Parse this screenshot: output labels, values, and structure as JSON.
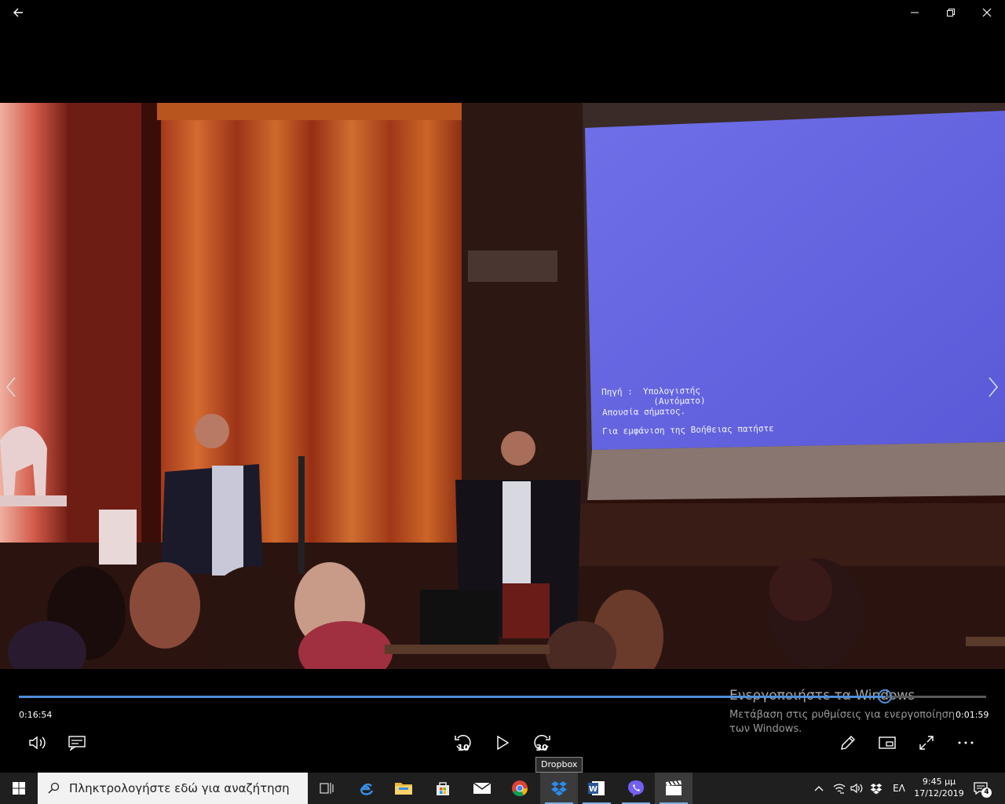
{
  "window": {
    "back_icon": "back-arrow-icon",
    "minimize_icon": "minimize-icon",
    "maximize_icon": "restore-icon",
    "close_icon": "close-icon"
  },
  "video": {
    "projected_screen": {
      "line1": "Πηγή :  Υπολογιστής",
      "line2": "          (Αυτόματο)",
      "line3": "Απουσία σήματος.",
      "line4": "Για εμφάνιση της Βοήθειας πατήστε"
    }
  },
  "player": {
    "elapsed": "0:16:54",
    "remaining": "0:01:59",
    "progress": 0.895,
    "skip_back_label": "10",
    "skip_forward_label": "30",
    "accent_color": "#4d8fd8"
  },
  "watermark": {
    "title": "Ενεργοποιήστε τα Windows",
    "subtitle": "Μετάβαση στις ρυθμίσεις για ενεργοποίηση των Windows."
  },
  "tooltip": {
    "text": "Dropbox"
  },
  "taskbar": {
    "search_placeholder": "Πληκτρολογήστε εδώ για αναζήτηση",
    "language": "ΕΛ",
    "time": "9:45 μμ",
    "date": "17/12/2019",
    "notification_count": "4"
  }
}
